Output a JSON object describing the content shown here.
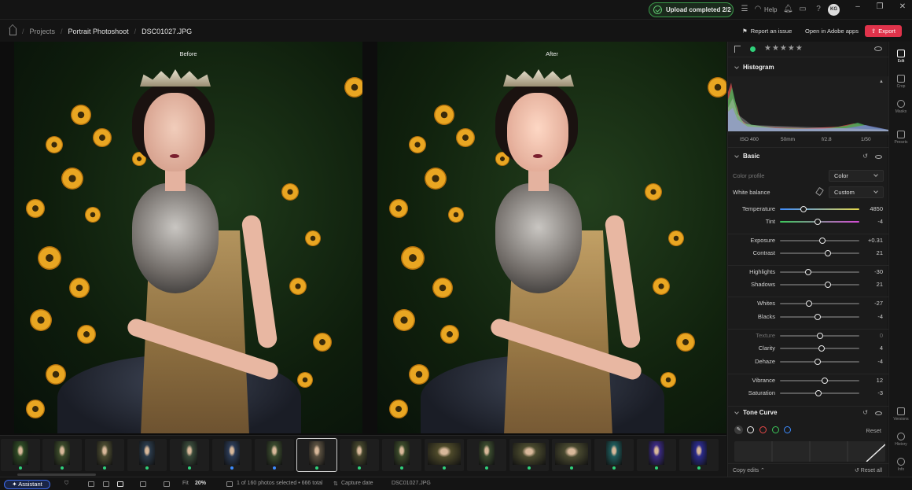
{
  "topbar": {
    "upload_status": "Upload completed 2/2",
    "help_label": "Help",
    "avatar_initials": "KG"
  },
  "breadcrumb": {
    "items": [
      "Projects",
      "Portrait Photoshoot",
      "DSC01027.JPG"
    ]
  },
  "actions": {
    "report_issue": "Report an issue",
    "open_adobe": "Open in Adobe apps",
    "export": "Export",
    "export_color": "#e0334b"
  },
  "viewer": {
    "before_label": "Before",
    "after_label": "After"
  },
  "panel": {
    "rating_stars": "★★★★★",
    "label_color": "#2fd07a",
    "histogram": {
      "title": "Histogram",
      "exif": [
        "ISO 400",
        "50mm",
        "f/2.8",
        "1/50"
      ]
    },
    "basic": {
      "title": "Basic",
      "color_profile_label": "Color profile",
      "color_profile_value": "Color",
      "white_balance_label": "White balance",
      "white_balance_value": "Custom",
      "sliders": [
        {
          "label": "Temperature",
          "value": "4850",
          "pos": 0.3
        },
        {
          "label": "Tint",
          "value": "-4",
          "pos": 0.48
        },
        {
          "label": "Exposure",
          "value": "+0.31",
          "pos": 0.53
        },
        {
          "label": "Contrast",
          "value": "21",
          "pos": 0.6
        },
        {
          "label": "Highlights",
          "value": "-30",
          "pos": 0.36
        },
        {
          "label": "Shadows",
          "value": "21",
          "pos": 0.6
        },
        {
          "label": "Whites",
          "value": "-27",
          "pos": 0.37
        },
        {
          "label": "Blacks",
          "value": "-4",
          "pos": 0.48
        },
        {
          "label": "Texture",
          "value": "0",
          "pos": 0.5
        },
        {
          "label": "Clarity",
          "value": "4",
          "pos": 0.52
        },
        {
          "label": "Dehaze",
          "value": "-4",
          "pos": 0.48
        },
        {
          "label": "Vibrance",
          "value": "12",
          "pos": 0.56
        },
        {
          "label": "Saturation",
          "value": "-3",
          "pos": 0.49
        }
      ]
    },
    "tone_curve": {
      "title": "Tone Curve",
      "reset": "Reset",
      "channel_colors": [
        "#eeeeee",
        "#e84848",
        "#3cc85a",
        "#3d8cff"
      ]
    },
    "footer": {
      "copy_edits": "Copy edits",
      "reset_all": "Reset all"
    }
  },
  "rail": {
    "items": [
      "Edit",
      "Crop",
      "Masks",
      "Presets",
      "Versions",
      "History",
      "Info"
    ]
  },
  "bottombar": {
    "assistant": "Assistant",
    "fit": "Fit",
    "zoom": "20%",
    "selection": "1 of 160 photos selected • 666 total",
    "sort": "Capture date",
    "filename": "DSC01027.JPG"
  }
}
